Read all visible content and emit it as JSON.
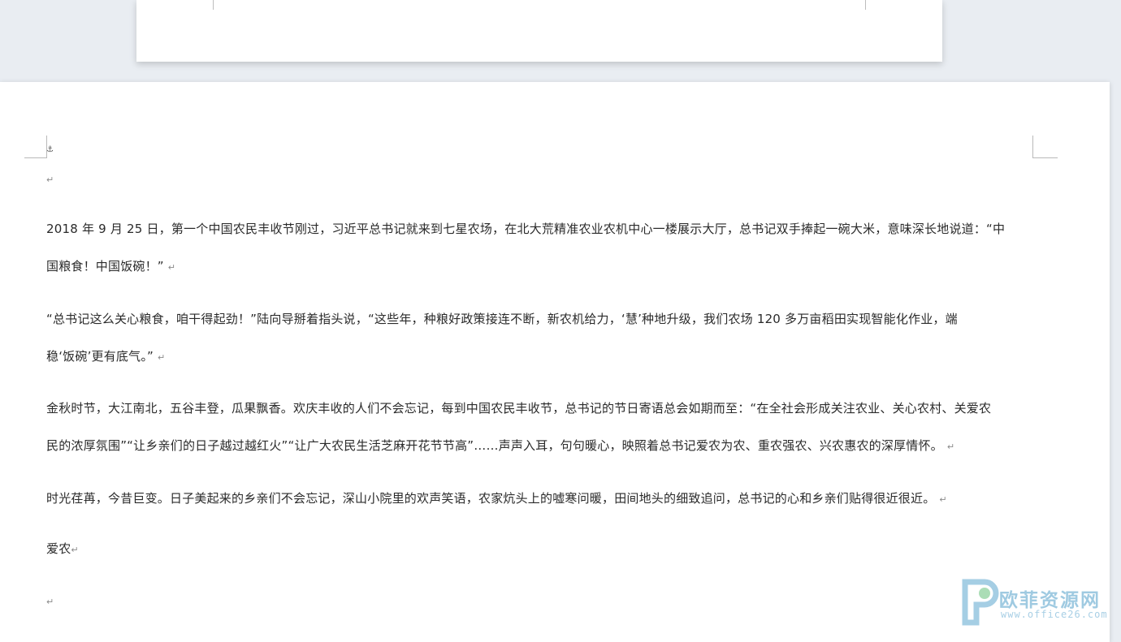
{
  "document": {
    "anchor_symbol": "⚓",
    "paragraph_mark": "↵",
    "paragraphs": [
      {
        "lines": [
          "2018 年 9 月 25 日，第一个中国农民丰收节刚过，习近平总书记就来到七星农场，在北大荒精准农业农机中心一楼展示大厅，总书记双手捧起一碗大米，意味深长地说道：“中",
          "国粮食！中国饭碗！”"
        ]
      },
      {
        "lines": [
          "“总书记这么关心粮食，咱干得起劲！”陆向导掰着指头说，“这些年，种粮好政策接连不断，新农机给力，‘慧’种地升级，我们农场 120 多万亩稻田实现智能化作业，端",
          "稳‘饭碗’更有底气。”"
        ]
      },
      {
        "lines": [
          "金秋时节，大江南北，五谷丰登，瓜果飘香。欢庆丰收的人们不会忘记，每到中国农民丰收节，总书记的节日寄语总会如期而至：“在全社会形成关注农业、关心农村、关爱农",
          "民的浓厚氛围”“让乡亲们的日子越过越红火”“让广大农民生活芝麻开花节节高”……声声入耳，句句暖心，映照着总书记爱农为农、重农强农、兴农惠农的深厚情怀。"
        ]
      },
      {
        "lines": [
          "时光荏苒，今昔巨变。日子美起来的乡亲们不会忘记，深山小院里的欢声笑语，农家炕头上的嘘寒问暖，田间地头的细致追问，总书记的心和乡亲们贴得很近很近。"
        ]
      },
      {
        "lines": [
          "爱农"
        ]
      }
    ]
  },
  "watermark": {
    "name": "欧菲资源网",
    "url": "www.office26.com",
    "colors": {
      "blue": "#7fb9d8",
      "green": "#8fd19e"
    }
  }
}
